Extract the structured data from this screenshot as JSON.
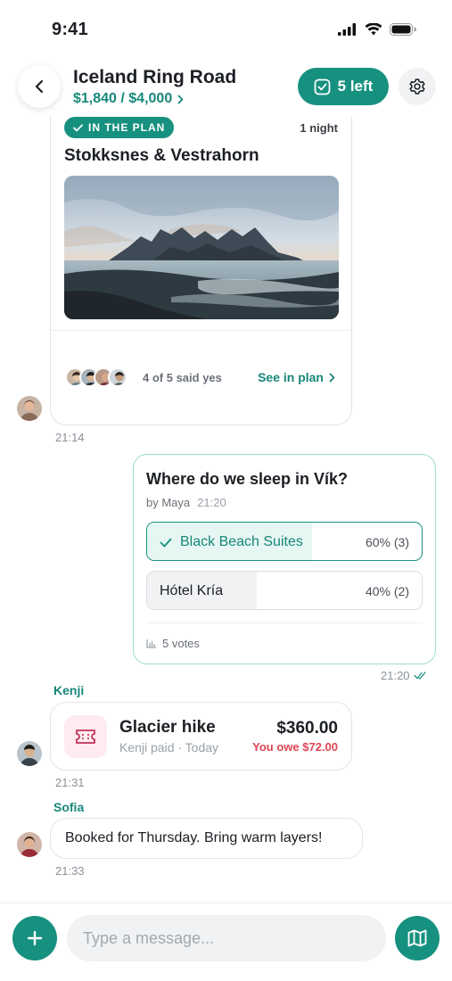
{
  "status_bar": {
    "time": "9:41"
  },
  "header": {
    "title": "Iceland Ring Road",
    "budget": "$1,840 / $4,000",
    "tasks_label": "5 left"
  },
  "plan_card": {
    "badge": "IN THE PLAN",
    "nights": "1 night",
    "place": "Stokksnes & Vestrahorn",
    "votes_summary": "4 of 5 said yes",
    "link_label": "See in plan",
    "time": "21:14"
  },
  "poll": {
    "question": "Where do we sleep in Vík?",
    "author": "by Maya",
    "posted": "21:20",
    "options": [
      {
        "label": "Black Beach Suites",
        "result": "60% (3)",
        "share": 0.6,
        "selected": true
      },
      {
        "label": "Hótel Kría",
        "result": "40% (2)",
        "share": 0.4,
        "selected": false
      }
    ],
    "votes_label": "5 votes",
    "time": "21:20"
  },
  "expense": {
    "sender": "Kenji",
    "title": "Glacier hike",
    "subtitle": "Kenji paid · Today",
    "amount": "$360.00",
    "owe": "You owe $72.00",
    "time": "21:31"
  },
  "message": {
    "sender": "Sofia",
    "text": "Booked for Thursday. Bring warm layers!",
    "time": "21:33"
  },
  "composer": {
    "placeholder": "Type a message..."
  },
  "colors": {
    "accent": "#17917f",
    "owe": "#e04454",
    "poll_border": "#9fdccf"
  }
}
